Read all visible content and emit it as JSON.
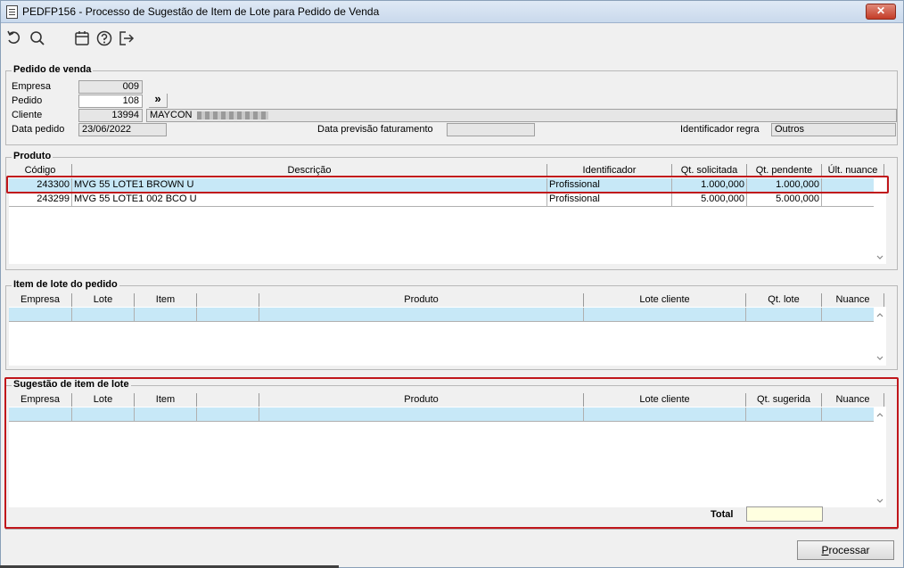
{
  "window": {
    "title": "PEDFP156 - Processo de Sugestão de Item de Lote para Pedido de Venda",
    "close_label": "✕"
  },
  "toolbar": {
    "icons": [
      "undo-icon",
      "search-icon",
      "calendar-icon",
      "help-icon",
      "exit-icon"
    ]
  },
  "pedido": {
    "legend": "Pedido de venda",
    "empresa_label": "Empresa",
    "empresa_value": "009",
    "pedido_label": "Pedido",
    "pedido_value": "108",
    "go_label": "»",
    "cliente_label": "Cliente",
    "cliente_code": "13994",
    "cliente_name": "MAYCON",
    "data_pedido_label": "Data pedido",
    "data_pedido_value": "23/06/2022",
    "data_prev_label": "Data previsão faturamento",
    "data_prev_value": "",
    "ident_regra_label": "Identificador regra",
    "ident_regra_value": "Outros"
  },
  "produto": {
    "legend": "Produto",
    "headers": [
      "Código",
      "Descrição",
      "Identificador",
      "Qt. solicitada",
      "Qt. pendente",
      "Últ. nuance"
    ],
    "rows": [
      [
        "243300",
        "MVG 55 LOTE1 BROWN U",
        "Profissional",
        "1.000,000",
        "1.000,000",
        ""
      ],
      [
        "243299",
        "MVG 55 LOTE1 002 BCO U",
        "Profissional",
        "5.000,000",
        "5.000,000",
        ""
      ]
    ]
  },
  "item_lote": {
    "legend": "Item de lote do pedido",
    "headers": [
      "Empresa",
      "Lote",
      "Item",
      "",
      "Produto",
      "Lote cliente",
      "Qt. lote",
      "Nuance"
    ]
  },
  "sugestao": {
    "legend": "Sugestão de item de lote",
    "headers": [
      "Empresa",
      "Lote",
      "Item",
      "",
      "Produto",
      "Lote cliente",
      "Qt. sugerida",
      "Nuance"
    ],
    "total_label": "Total",
    "total_value": ""
  },
  "actions": {
    "process_label_u": "P",
    "process_label_rest": "rocessar"
  },
  "colors": {
    "highlight": "#c0161b",
    "selection": "#c7e8f7",
    "total_bg": "#ffffe0"
  }
}
